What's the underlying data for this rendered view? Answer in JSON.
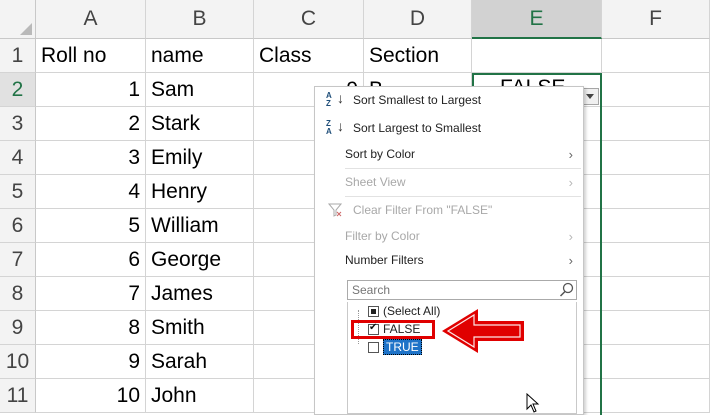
{
  "columns": [
    "A",
    "B",
    "C",
    "D",
    "E",
    "F"
  ],
  "header_row": {
    "a": "Roll no",
    "b": "name",
    "c": "Class",
    "d": "Section"
  },
  "rows": [
    {
      "n": "2",
      "a": "1",
      "b": "Sam",
      "c": "9",
      "d": "B"
    },
    {
      "n": "3",
      "a": "2",
      "b": "Stark",
      "c": "",
      "d": ""
    },
    {
      "n": "4",
      "a": "3",
      "b": "Emily",
      "c": "",
      "d": ""
    },
    {
      "n": "5",
      "a": "4",
      "b": "Henry",
      "c": "",
      "d": ""
    },
    {
      "n": "6",
      "a": "5",
      "b": "William",
      "c": "",
      "d": ""
    },
    {
      "n": "7",
      "a": "6",
      "b": "George",
      "c": "",
      "d": ""
    },
    {
      "n": "8",
      "a": "7",
      "b": "James",
      "c": "",
      "d": ""
    },
    {
      "n": "9",
      "a": "8",
      "b": "Smith",
      "c": "",
      "d": ""
    },
    {
      "n": "10",
      "a": "9",
      "b": "Sarah",
      "c": "",
      "d": ""
    },
    {
      "n": "11",
      "a": "10",
      "b": "John",
      "c": "",
      "d": ""
    }
  ],
  "row1_number": "1",
  "e2_value": "FALSE",
  "menu": {
    "sort_asc": "Sort Smallest to Largest",
    "sort_asc_icon_top": "A",
    "sort_asc_icon_bottom": "Z",
    "sort_desc": "Sort Largest to Smallest",
    "sort_desc_icon_top": "Z",
    "sort_desc_icon_bottom": "A",
    "sort_by_color": "Sort by Color",
    "sheet_view": "Sheet View",
    "clear_filter": "Clear Filter From \"FALSE\"",
    "filter_by_color": "Filter by Color",
    "number_filters": "Number Filters",
    "search_placeholder": "Search",
    "select_all": "(Select All)",
    "item_false": "FALSE",
    "item_true": "TRUE"
  },
  "colors": {
    "accent": "#217346",
    "annotation": "#e00000",
    "selection": "#1e73c8"
  }
}
